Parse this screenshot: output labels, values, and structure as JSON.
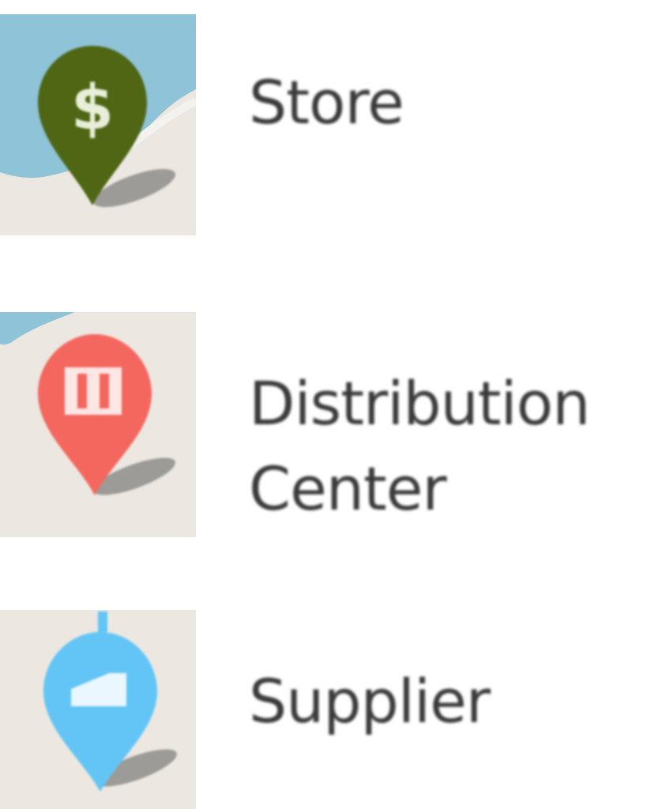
{
  "legend": {
    "items": [
      {
        "label": "Store",
        "icon": "dollar-map-pin-icon",
        "color": "#4f6614",
        "map_colors": {
          "water": "#8fc3d8",
          "land": "#ece8e1"
        }
      },
      {
        "label": "Distribution Center",
        "icon": "warehouse-map-pin-icon",
        "color": "#f4675f",
        "map_colors": {
          "water": "#8fc3d8",
          "land": "#ece8e1"
        }
      },
      {
        "label": "Supplier",
        "icon": "truck-map-pin-icon",
        "color": "#62c5f5",
        "map_colors": {
          "water": "#8fc3d8",
          "land": "#ece8e1"
        }
      }
    ]
  }
}
